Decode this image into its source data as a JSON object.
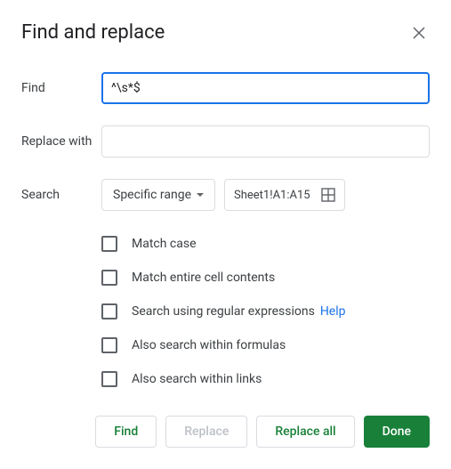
{
  "title": "Find and replace",
  "labels": {
    "find": "Find",
    "replace_with": "Replace with",
    "search": "Search"
  },
  "find": {
    "value": "^\\s*$"
  },
  "replace_with": {
    "value": ""
  },
  "search": {
    "dropdown_label": "Specific range",
    "range": "Sheet1!A1:A15"
  },
  "options": [
    {
      "label": "Match case"
    },
    {
      "label": "Match entire cell contents"
    },
    {
      "label": "Search using regular expressions",
      "help": "Help"
    },
    {
      "label": "Also search within formulas"
    },
    {
      "label": "Also search within links"
    }
  ],
  "buttons": {
    "find": "Find",
    "replace": "Replace",
    "replace_all": "Replace all",
    "done": "Done"
  }
}
